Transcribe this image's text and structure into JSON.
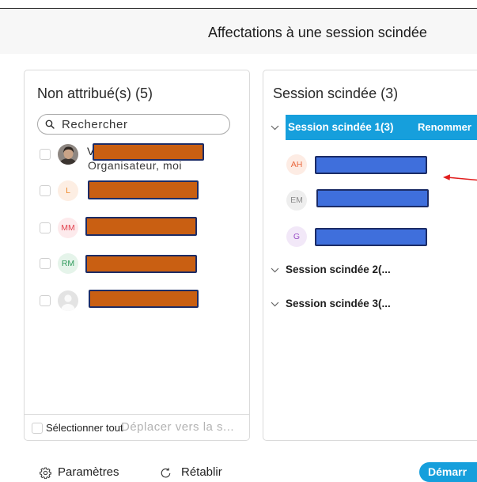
{
  "window": {
    "title": "Affectations à une session scindée"
  },
  "colors": {
    "accent_blue": "#169fdc",
    "redaction_orange": "#c95f12",
    "redaction_blue": "#3f6fdc",
    "redaction_border": "#1c2c66",
    "annotation_arrow": "#e11d1d"
  },
  "unassigned_panel": {
    "title": "Non attribué(s) (5)",
    "search": {
      "placeholder": "Rechercher",
      "icon": "search-icon"
    },
    "participants": [
      {
        "avatar_icon": "user-photo-avatar-icon",
        "name_visible": "V",
        "role": "Organisateur, moi",
        "name_redacted": true,
        "checked": false
      },
      {
        "initials": "L",
        "avatar_bg": "#fdeee3",
        "avatar_fg": "#ee8a2a",
        "name_redacted": true,
        "checked": false
      },
      {
        "initials": "MM",
        "avatar_bg": "#fdeaec",
        "avatar_fg": "#e2434f",
        "name_redacted": true,
        "checked": false
      },
      {
        "initials": "RM",
        "avatar_bg": "#e5f4ea",
        "avatar_fg": "#2f9a5b",
        "name_redacted": true,
        "checked": false
      },
      {
        "avatar_icon": "person-silhouette-icon",
        "name_redacted": true,
        "checked": false
      }
    ],
    "footer": {
      "select_all_label": "Sélectionner tout",
      "select_all_checked": false,
      "move_button_label": "Déplacer vers la s...",
      "move_button_enabled": false
    }
  },
  "sessions_panel": {
    "title": "Session scindée (3)",
    "sessions": [
      {
        "label": "Session scindée 1(3)",
        "expanded": true,
        "selected": true,
        "rename_label": "Renommer",
        "members": [
          {
            "initials": "AH",
            "avatar_bg": "#fdece4",
            "avatar_fg": "#e9673d",
            "name_redacted": true
          },
          {
            "initials": "EM",
            "avatar_bg": "#eeeeee",
            "avatar_fg": "#8c8c8c",
            "name_redacted": true
          },
          {
            "initials": "G",
            "avatar_bg": "#f2e8f8",
            "avatar_fg": "#9a4fc6",
            "name_redacted": true
          }
        ]
      },
      {
        "label": "Session scindée 2(...",
        "expanded": false
      },
      {
        "label": "Session scindée 3(...",
        "expanded": false
      }
    ]
  },
  "bottom_bar": {
    "settings": {
      "label": "Paramètres",
      "icon": "gear-icon"
    },
    "reset": {
      "label": "Rétablir",
      "icon": "refresh-icon"
    },
    "start": {
      "label": "Démarr"
    }
  }
}
